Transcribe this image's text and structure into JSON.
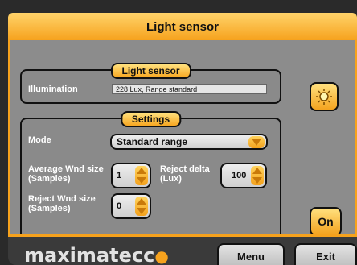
{
  "window": {
    "title": "Light sensor"
  },
  "light_sensor_group": {
    "title": "Light sensor",
    "illumination_label": "Illumination",
    "illumination_value": "228 Lux, Range standard"
  },
  "settings_group": {
    "title": "Settings",
    "mode_label": "Mode",
    "mode_value": "Standard range",
    "average_label_1": "Average Wnd size",
    "average_label_2": "(Samples)",
    "average_value": "1",
    "reject_delta_label_1": "Reject delta",
    "reject_delta_label_2": "(Lux)",
    "reject_delta_value": "100",
    "reject_wnd_label_1": "Reject Wnd size",
    "reject_wnd_label_2": "(Samples)",
    "reject_wnd_value": "0"
  },
  "side_buttons": {
    "sensor_icon": "light-bulb-icon",
    "on_label": "On"
  },
  "footer": {
    "logo_text": "maximatecc",
    "menu_label": "Menu",
    "exit_label": "Exit"
  },
  "colors": {
    "accent": "#f6a21d",
    "panel": "#8c8c8c",
    "footer": "#3a3a3a"
  }
}
